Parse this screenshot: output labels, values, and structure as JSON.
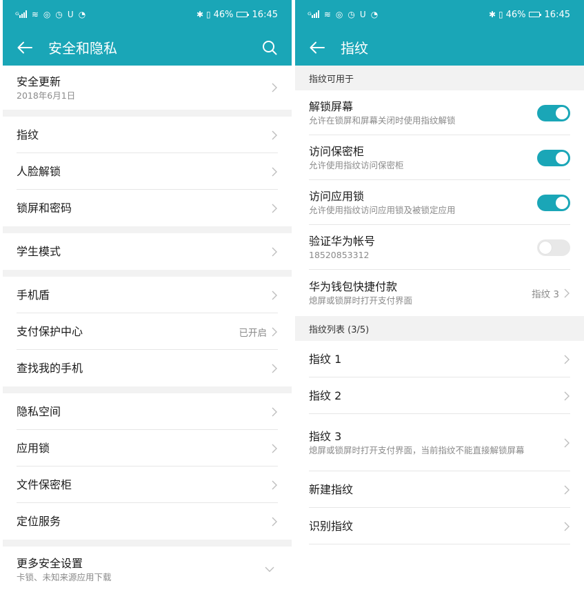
{
  "theme": {
    "accent": "#1aa6b7",
    "divider": "#e6e6e6",
    "section_bg": "#f2f2f2"
  },
  "status_bar": {
    "battery": "46%",
    "time": "16:45",
    "network": "4G",
    "icons": [
      "signal-icon",
      "wifi-icon",
      "alarm-icon",
      "clock-icon",
      "app-icon",
      "bluetooth-icon",
      "vibrate-icon",
      "battery-icon"
    ]
  },
  "left": {
    "title": "安全和隐私",
    "rows": {
      "security_update": {
        "title": "安全更新",
        "sub": "2018年6月1日"
      },
      "fingerprint": {
        "title": "指纹"
      },
      "face_unlock": {
        "title": "人脸解锁"
      },
      "lock_screen": {
        "title": "锁屏和密码"
      },
      "student_mode": {
        "title": "学生模式"
      },
      "phone_shield": {
        "title": "手机盾"
      },
      "payment_protection": {
        "title": "支付保护中心",
        "value": "已开启"
      },
      "find_phone": {
        "title": "查找我的手机"
      },
      "private_space": {
        "title": "隐私空间"
      },
      "app_lock": {
        "title": "应用锁"
      },
      "file_safe": {
        "title": "文件保密柜"
      },
      "location": {
        "title": "定位服务"
      },
      "more_security": {
        "title": "更多安全设置",
        "sub": "卡锁、未知来源应用下载"
      }
    }
  },
  "right": {
    "title": "指纹",
    "section_usage": "指纹可用于",
    "section_list": "指纹列表 (3/5)",
    "rows": {
      "unlock_screen": {
        "title": "解锁屏幕",
        "sub": "允许在锁屏和屏幕关闭时使用指纹解锁",
        "toggle": true
      },
      "access_safe": {
        "title": "访问保密柜",
        "sub": "允许使用指纹访问保密柜",
        "toggle": true
      },
      "access_app_lock": {
        "title": "访问应用锁",
        "sub": "允许使用指纹访问应用锁及被锁定应用",
        "toggle": true
      },
      "verify_huawei": {
        "title": "验证华为帐号",
        "sub": "18520853312",
        "toggle": false
      },
      "wallet_pay": {
        "title": "华为钱包快捷付款",
        "sub": "熄屏或锁屏时打开支付界面",
        "value": "指纹 3"
      },
      "fp1": {
        "title": "指纹 1"
      },
      "fp2": {
        "title": "指纹 2"
      },
      "fp3": {
        "title": "指纹 3",
        "sub": "熄屏或锁屏时打开支付界面，当前指纹不能直接解锁屏幕"
      },
      "new_fp": {
        "title": "新建指纹"
      },
      "identify_fp": {
        "title": "识别指纹"
      }
    }
  }
}
